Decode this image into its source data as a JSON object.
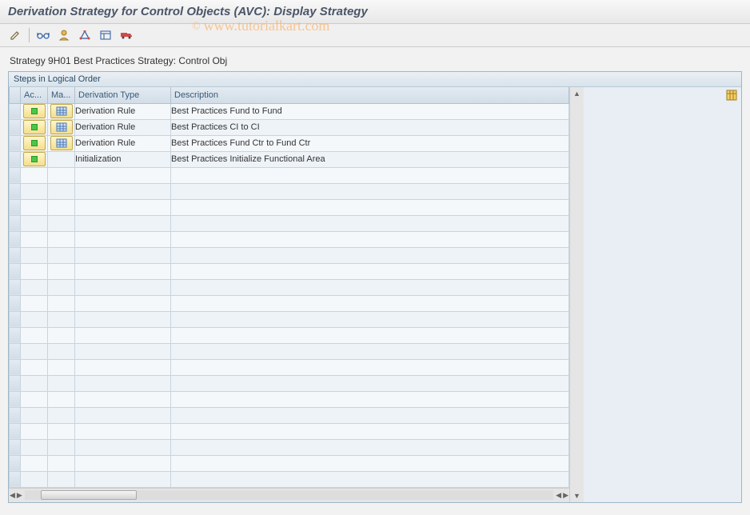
{
  "header": {
    "title": "Derivation Strategy for Control Objects (AVC): Display Strategy"
  },
  "watermark": {
    "text": "www.tutorialkart.com",
    "copyright": "©"
  },
  "toolbar": {
    "icons": [
      "change-icon",
      "glasses-icon",
      "user-icon",
      "path-icon",
      "grid-icon",
      "truck-icon"
    ]
  },
  "strategy_line": "Strategy 9H01 Best Practices Strategy: Control Obj",
  "panel": {
    "title": "Steps in Logical Order",
    "columns": {
      "active": "Ac...",
      "maint": "Ma...",
      "type": "Derivation Type",
      "desc": "Description"
    },
    "rows": [
      {
        "active": true,
        "maint": true,
        "type": "Derivation Rule",
        "desc": "Best Practices Fund to Fund"
      },
      {
        "active": true,
        "maint": true,
        "type": "Derivation Rule",
        "desc": "Best Practices CI to CI"
      },
      {
        "active": true,
        "maint": true,
        "type": "Derivation Rule",
        "desc": "Best Practices Fund Ctr to Fund Ctr"
      },
      {
        "active": true,
        "maint": false,
        "type": "Initialization",
        "desc": "Best Practices Initialize Functional Area"
      }
    ],
    "empty_rows": 20
  }
}
